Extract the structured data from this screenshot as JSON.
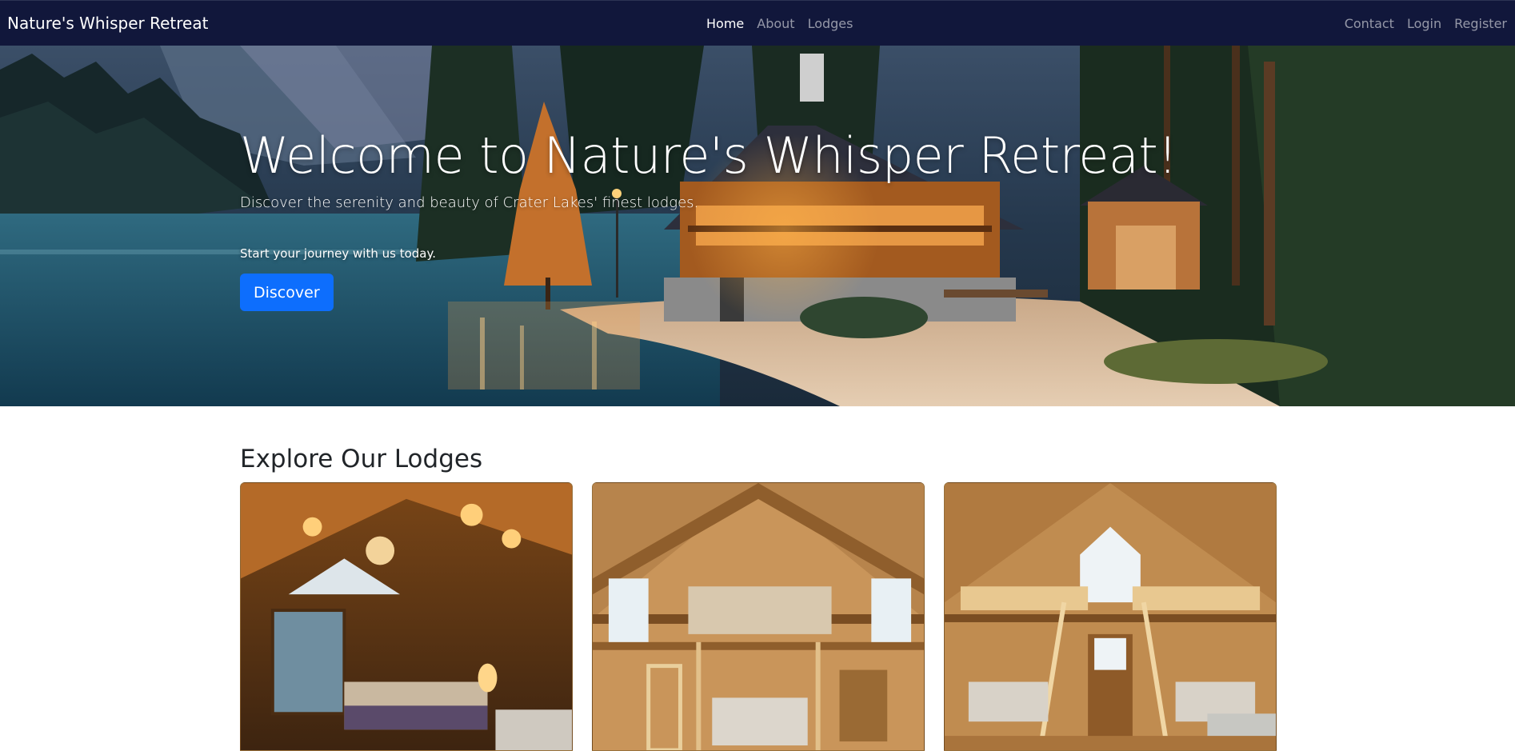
{
  "navbar": {
    "brand": "Nature's Whisper Retreat",
    "left_links": [
      {
        "label": "Home",
        "active": true
      },
      {
        "label": "About",
        "active": false
      },
      {
        "label": "Lodges",
        "active": false
      }
    ],
    "right_links": [
      {
        "label": "Contact"
      },
      {
        "label": "Login"
      },
      {
        "label": "Register"
      }
    ]
  },
  "hero": {
    "title": "Welcome to Nature's Whisper Retreat!",
    "subtitle": "Discover the serenity and beauty of Crater Lakes' finest lodges.",
    "cta_text": "Start your journey with us today.",
    "button_label": "Discover",
    "image": "lakeside-lodge-at-dusk"
  },
  "lodges": {
    "title": "Explore Our Lodges",
    "cards": [
      {
        "image": "cabin-bedroom-interior"
      },
      {
        "image": "loft-cabin-interior"
      },
      {
        "image": "bunk-loft-cabin-interior"
      }
    ]
  },
  "colors": {
    "navbar_bg": "#11173b",
    "primary_button": "#0d6efd",
    "nav_inactive": "rgba(255,255,255,0.55)"
  }
}
